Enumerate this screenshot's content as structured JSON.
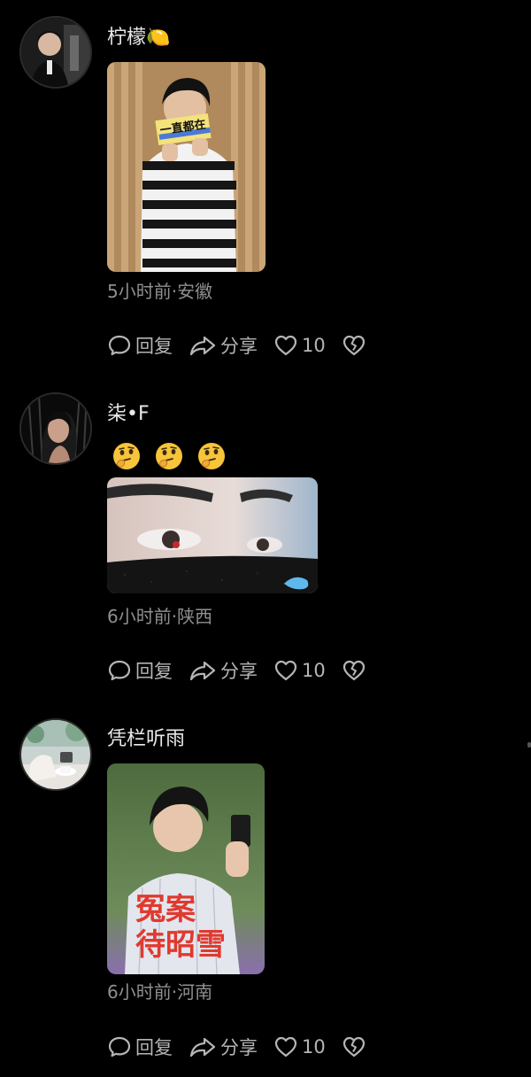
{
  "comments": [
    {
      "username": "柠檬🍋",
      "meta": "5小时前·安徽",
      "sign_text": "一直都在",
      "reply_label": "回复",
      "share_label": "分享",
      "like_count": "10"
    },
    {
      "username": "柒•F",
      "meta": "6小时前·陕西",
      "emojis": [
        "thinking-face-emoji",
        "thinking-face-emoji",
        "thinking-face-emoji"
      ],
      "reply_label": "回复",
      "share_label": "分享",
      "like_count": "10"
    },
    {
      "username": "凭栏听雨",
      "meta": "6小时前·河南",
      "overlay_text_1": "冤案",
      "overlay_text_2": "待昭雪",
      "reply_label": "回复",
      "share_label": "分享",
      "like_count": "10"
    }
  ],
  "colors": {
    "background": "#000000",
    "username": "#e9e9e9",
    "meta": "#8f8f8f",
    "action": "#b5b5b5",
    "overlay_red": "#e03a2f"
  },
  "icons": [
    "comment-bubble-icon",
    "share-arrow-icon",
    "heart-icon",
    "broken-heart-icon"
  ]
}
